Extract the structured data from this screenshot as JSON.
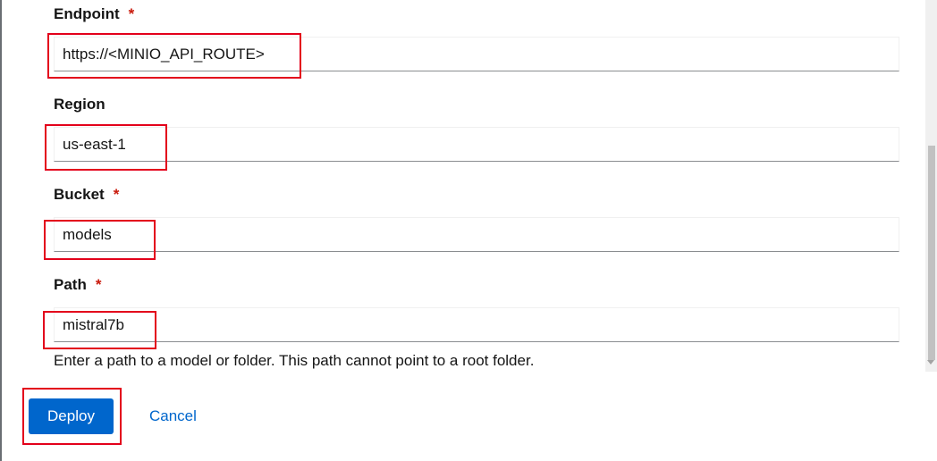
{
  "form": {
    "endpoint": {
      "label": "Endpoint",
      "required_mark": "*",
      "value": "https://<MINIO_API_ROUTE>"
    },
    "region": {
      "label": "Region",
      "value": "us-east-1"
    },
    "bucket": {
      "label": "Bucket",
      "required_mark": "*",
      "value": "models"
    },
    "path": {
      "label": "Path",
      "required_mark": "*",
      "value": "mistral7b",
      "helper": "Enter a path to a model or folder. This path cannot point to a root folder."
    }
  },
  "actions": {
    "deploy_label": "Deploy",
    "cancel_label": "Cancel"
  },
  "colors": {
    "primary": "#0066cc",
    "required": "#c9190b",
    "highlight": "#e3001b"
  }
}
